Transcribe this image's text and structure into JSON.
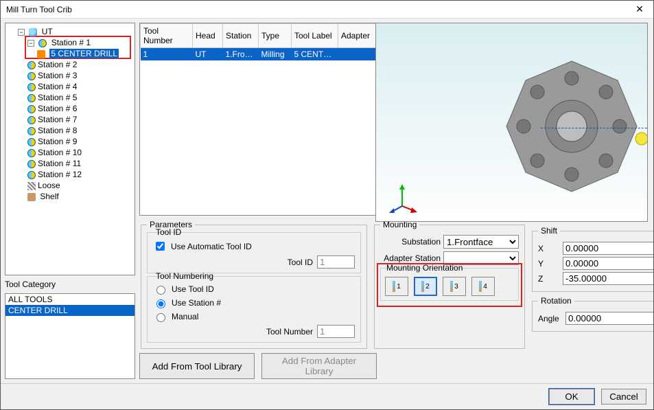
{
  "window": {
    "title": "Mill Turn Tool Crib"
  },
  "tree": {
    "root": "UT",
    "stations": [
      "Station # 1",
      "Station # 2",
      "Station # 3",
      "Station # 4",
      "Station # 5",
      "Station # 6",
      "Station # 7",
      "Station # 8",
      "Station # 9",
      "Station # 10",
      "Station # 11",
      "Station # 12"
    ],
    "station1_tool": "5 CENTER DRILL",
    "loose": "Loose",
    "shelf": "Shelf"
  },
  "category": {
    "label": "Tool Category",
    "items": {
      "all": "ALL TOOLS",
      "selected": "CENTER DRILL"
    }
  },
  "table": {
    "headers": {
      "toolno": "Tool Number",
      "head": "Head",
      "station": "Station",
      "type": "Type",
      "label": "Tool Label",
      "adapter": "Adapter"
    },
    "row": {
      "toolno": "1",
      "head": "UT",
      "station": "1.Fro…",
      "type": "Milling",
      "label": "5 CENTE…",
      "adapter": ""
    }
  },
  "params": {
    "legend": "Parameters",
    "toolid_legend": "Tool ID",
    "auto_label": "Use Automatic Tool ID",
    "toolid_label": "Tool ID",
    "toolid_value": "1",
    "numbering_legend": "Tool Numbering",
    "use_toolid": "Use Tool ID",
    "use_station": "Use Station #",
    "manual": "Manual",
    "toolno_label": "Tool Number",
    "toolno_value": "1"
  },
  "mounting": {
    "legend": "Mounting",
    "substation_label": "Substation",
    "substation_value": "1.Frontface",
    "adapter_label": "Adapter Station",
    "adapter_value": "",
    "orient_legend": "Mounting Orientation",
    "orient_btns": [
      "1",
      "2",
      "3",
      "4"
    ]
  },
  "shift": {
    "legend": "Shift",
    "x_label": "X",
    "x": "0.00000",
    "y_label": "Y",
    "y": "0.00000",
    "z_label": "Z",
    "z": "-35.00000"
  },
  "rotation": {
    "legend": "Rotation",
    "angle_label": "Angle",
    "angle": "0.00000"
  },
  "buttons": {
    "add_tool": "Add From Tool Library",
    "add_adapter": "Add From Adapter Library",
    "ok": "OK",
    "cancel": "Cancel"
  }
}
